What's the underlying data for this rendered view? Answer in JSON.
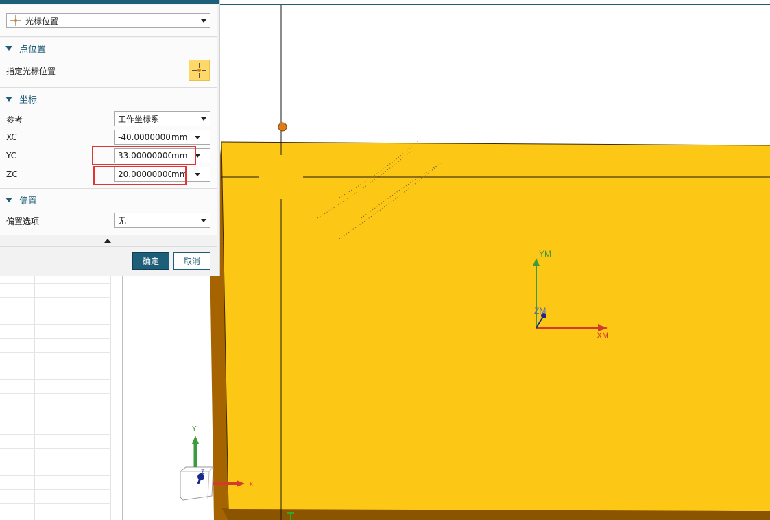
{
  "dialog": {
    "type_dropdown": {
      "value": "光标位置",
      "icon": "cursor-position-icon"
    },
    "point_section": {
      "title": "点位置",
      "specify_label": "指定光标位置",
      "icon": "crosshair-point-icon"
    },
    "coord_section": {
      "title": "坐标",
      "reference_label": "参考",
      "reference_value": "工作坐标系",
      "xc_label": "XC",
      "xc_value": "-40.00000000",
      "xc_unit": "mm",
      "yc_label": "YC",
      "yc_value": "33.00000000",
      "yc_unit": "mm",
      "zc_label": "ZC",
      "zc_value": "20.00000000",
      "zc_unit": "mm"
    },
    "offset_section": {
      "title": "偏置",
      "option_label": "偏置选项",
      "option_value": "无"
    },
    "ok_label": "确定",
    "cancel_label": "取消",
    "accent_color": "#1f5e78",
    "highlight_color": "#e03535"
  },
  "viewport": {
    "block_color": "#fdc815",
    "block_side_color": "#a56400",
    "wcs_labels": {
      "x": "XM",
      "y": "YM",
      "z": "ZM"
    },
    "triad_labels": {
      "x": "X",
      "y": "Y",
      "z": "Z"
    }
  }
}
